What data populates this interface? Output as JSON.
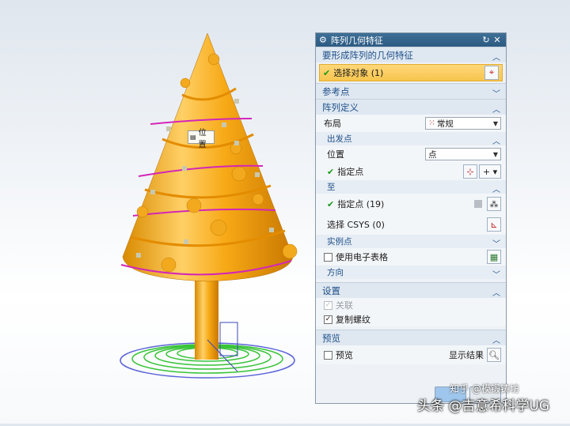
{
  "tooltip": {
    "label": "位置",
    "icon": "list-icon"
  },
  "dialog": {
    "title": "阵列几何特征",
    "title_icon": "gear-icon",
    "sections": {
      "geometry": {
        "label": "要形成阵列的几何特征",
        "select_label": "选择对象 (1)"
      },
      "ref_point": {
        "label": "参考点"
      },
      "array_def": {
        "label": "阵列定义",
        "layout_label": "布局",
        "layout_value": "常规",
        "from": {
          "label": "出发点",
          "position_label": "位置",
          "position_value": "点",
          "specify_point": "指定点"
        },
        "to": {
          "label": "至",
          "specify_point": "指定点 (19)",
          "select_csys": "选择 CSYS (0)"
        },
        "instance_points": {
          "label": "实例点",
          "use_spreadsheet": "使用电子表格"
        },
        "direction": {
          "label": "方向"
        }
      },
      "settings": {
        "label": "设置",
        "associative": "关联",
        "copy_threads": "复制螺纹"
      },
      "preview": {
        "label": "预览",
        "preview_check": "预览",
        "show_result": "显示结果"
      }
    }
  },
  "watermark": "头条 @吉意希科学UG",
  "watermark_top": "知乎 @模锻铸坊"
}
